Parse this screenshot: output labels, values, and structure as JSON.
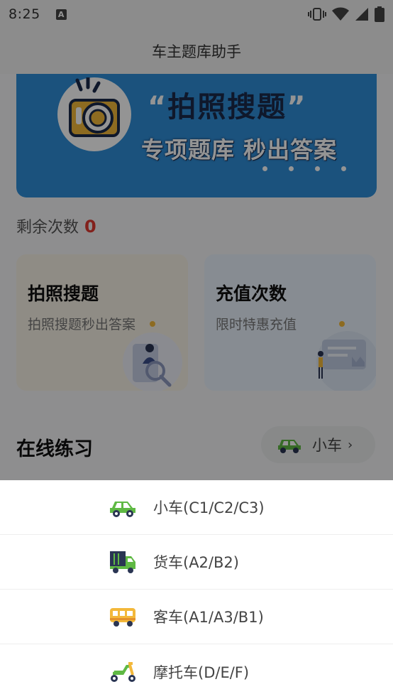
{
  "status_bar": {
    "time": "8:25",
    "notification_icon": "A"
  },
  "app_bar": {
    "title": "车主题库助手"
  },
  "banner": {
    "title": "拍照搜题",
    "open_quote": "“",
    "close_quote": "”",
    "subtitle": "专项题库 秒出答案"
  },
  "remaining": {
    "label": "剩余次数",
    "count": "0"
  },
  "cards": [
    {
      "title": "拍照搜题",
      "subtitle": "拍照搜题秒出答案"
    },
    {
      "title": "充值次数",
      "subtitle": "限时特惠充值"
    }
  ],
  "practice": {
    "title": "在线练习",
    "selected_vehicle": "小车",
    "chevron": "›"
  },
  "vehicle_sheet": {
    "options": [
      {
        "label": "小车(C1/C2/C3)",
        "icon": "car-icon"
      },
      {
        "label": "货车(A2/B2)",
        "icon": "truck-icon"
      },
      {
        "label": "客车(A1/A3/B1)",
        "icon": "bus-icon"
      },
      {
        "label": "摩托车(D/E/F)",
        "icon": "scooter-icon"
      }
    ]
  },
  "colors": {
    "accent_red": "#e03a31",
    "banner_blue": "#2f8ed8",
    "icon_green": "#5fb944",
    "icon_yellow": "#f3b83a"
  }
}
